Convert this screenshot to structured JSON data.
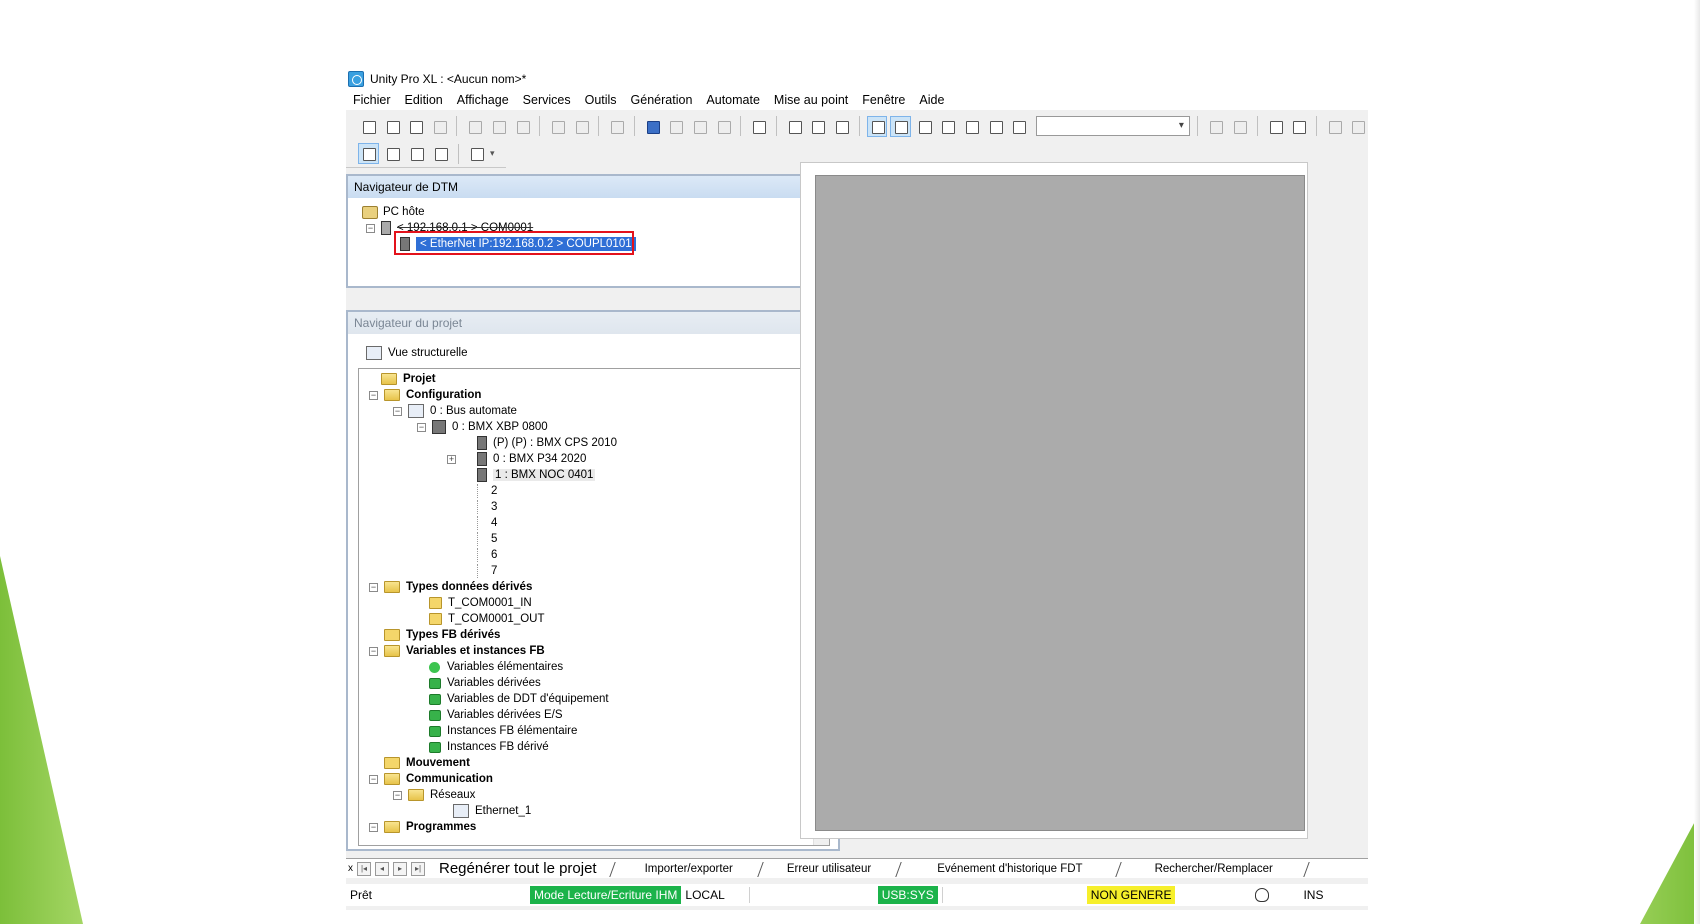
{
  "window": {
    "title": "Unity Pro XL : <Aucun nom>*"
  },
  "menu": [
    "Fichier",
    "Edition",
    "Affichage",
    "Services",
    "Outils",
    "Génération",
    "Automate",
    "Mise au point",
    "Fenêtre",
    "Aide"
  ],
  "dtm_navigator": {
    "title": "Navigateur de DTM",
    "items": [
      "PC hôte",
      "< 192.168.0.1 > COM0001",
      "< EtherNet IP:192.168.0.2 > COUPL0101"
    ]
  },
  "project_navigator": {
    "title": "Navigateur du projet",
    "view": "Vue structurelle",
    "tree": {
      "project": "Projet",
      "configuration": "Configuration",
      "bus": "0 : Bus automate",
      "rack": "0 : BMX XBP 0800",
      "modules": [
        "(P) (P) : BMX CPS 2010",
        "0 : BMX P34 2020",
        "1 : BMX NOC 0401"
      ],
      "slots": [
        "2",
        "3",
        "4",
        "5",
        "6",
        "7"
      ],
      "derived_types": "Types données dérivés",
      "derived_type_items": [
        "T_COM0001_IN",
        "T_COM0001_OUT"
      ],
      "fb_types": "Types FB dérivés",
      "variables": "Variables et instances FB",
      "variable_items": [
        "Variables élémentaires",
        "Variables dérivées",
        "Variables de DDT d'équipement",
        "Variables dérivées E/S",
        "Instances FB élémentaire",
        "Instances FB dérivé"
      ],
      "movement": "Mouvement",
      "communication": "Communication",
      "networks": "Réseaux",
      "ethernet": "Ethernet_1",
      "programs": "Programmes"
    }
  },
  "bottom_tabs": [
    "Regénérer tout le projet",
    "Importer/exporter",
    "Erreur utilisateur",
    "Evénement d'historique FDT",
    "Rechercher/Remplacer"
  ],
  "status": {
    "ready": "Prêt",
    "mode": "Mode Lecture/Ecriture IHM",
    "local": "LOCAL",
    "usb": "USB:SYS",
    "generated": "NON GENERE",
    "ins": "INS"
  },
  "colors": {
    "green_status": "#1bb34a",
    "yellow_status": "#f6ef2a",
    "selection": "#2f6fd6",
    "highlight_box": "#e3121b"
  }
}
